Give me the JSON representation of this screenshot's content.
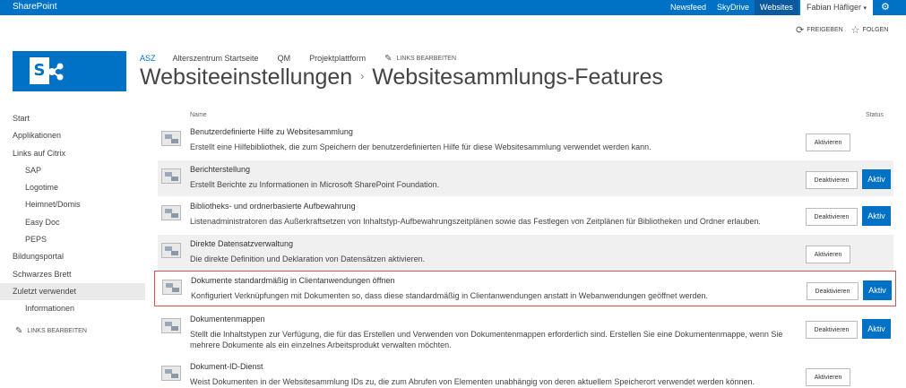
{
  "suite_bar": {
    "brand": "SharePoint",
    "nav": [
      {
        "label": "Newsfeed",
        "active": false
      },
      {
        "label": "SkyDrive",
        "active": false
      },
      {
        "label": "Websites",
        "active": true
      }
    ],
    "user": "Fabian Häfliger",
    "settings_icon": "gear-icon"
  },
  "page_actions": {
    "share": {
      "label": "FREIGEBEN",
      "icon": "share-icon"
    },
    "follow": {
      "label": "FOLGEN",
      "icon": "star-icon"
    }
  },
  "logo": {
    "letter": "S",
    "icon": "sharepoint-logo-icon"
  },
  "top_links": {
    "items": [
      "ASZ",
      "Alterszentrum Startseite",
      "QM",
      "Projektplattform"
    ],
    "edit_label": "LINKS BEARBEITEN"
  },
  "breadcrumb": {
    "parent": "Websiteeinstellungen",
    "separator": "›",
    "current": "Websitesammlungs-Features"
  },
  "left_nav": {
    "items": [
      {
        "label": "Start",
        "level": 0
      },
      {
        "label": "Applikationen",
        "level": 0
      },
      {
        "label": "Links auf Citrix",
        "level": 0
      },
      {
        "label": "SAP",
        "level": 1
      },
      {
        "label": "Logotime",
        "level": 1
      },
      {
        "label": "Heimnet/Domis",
        "level": 1
      },
      {
        "label": "Easy Doc",
        "level": 1
      },
      {
        "label": "PEPS",
        "level": 1
      },
      {
        "label": "Bildungsportal",
        "level": 0
      },
      {
        "label": "Schwarzes Brett",
        "level": 0
      },
      {
        "label": "Zuletzt verwendet",
        "level": 0,
        "selected": true
      },
      {
        "label": "Informationen",
        "level": 1
      }
    ],
    "edit_label": "LINKS BEARBEITEN"
  },
  "table": {
    "header_name": "Name",
    "header_status": "Status",
    "activate_label": "Aktivieren",
    "deactivate_label": "Deaktivieren",
    "active_label": "Aktiv",
    "features": [
      {
        "name": "Benutzerdefinierte Hilfe zu Websitesammlung",
        "description": "Erstellt eine Hilfebibliothek, die zum Speichern der benutzerdefinierten Hilfe für diese Websitesammlung verwendet werden kann.",
        "active": false
      },
      {
        "name": "Berichterstellung",
        "description": "Erstellt Berichte zu Informationen in Microsoft SharePoint Foundation.",
        "active": true
      },
      {
        "name": "Bibliotheks- und ordnerbasierte Aufbewahrung",
        "description": "Listenadministratoren das Außerkraftsetzen von Inhaltstyp-Aufbewahrungszeitplänen sowie das Festlegen von Zeitplänen für Bibliotheken und Ordner erlauben.",
        "active": true
      },
      {
        "name": "Direkte Datensatzverwaltung",
        "description": "Die direkte Definition und Deklaration von Datensätzen aktivieren.",
        "active": false
      },
      {
        "name": "Dokumente standardmäßig in Clientanwendungen öffnen",
        "description": "Konfiguriert Verknüpfungen mit Dokumenten so, dass diese standardmäßig in Clientanwendungen anstatt in Webanwendungen geöffnet werden.",
        "active": true,
        "highlighted": true
      },
      {
        "name": "Dokumentenmappen",
        "description": "Stellt die Inhaltstypen zur Verfügung, die für das Erstellen und Verwenden von Dokumentenmappen erforderlich sind. Erstellen Sie eine Dokumentenmappe, wenn Sie mehrere Dokumente als ein einzelnes Arbeitsprodukt verwalten möchten.",
        "active": true
      },
      {
        "name": "Dokument-ID-Dienst",
        "description": "Weist Dokumenten in der Websitesammlung IDs zu, die zum Abrufen von Elementen unabhängig von deren aktuellem Speicherort verwendet werden können.",
        "active": false
      }
    ]
  },
  "colors": {
    "brand_blue": "#0072c6",
    "highlight_border": "#d9534f",
    "row_shade": "#f0f0f0"
  }
}
